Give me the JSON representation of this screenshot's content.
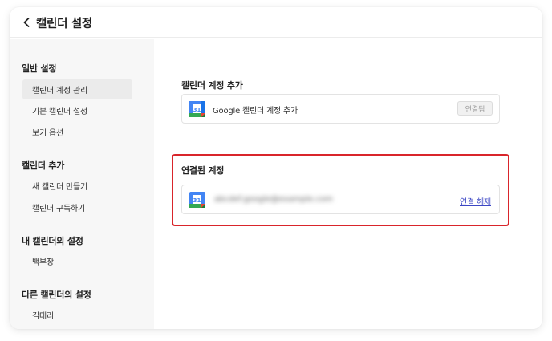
{
  "header": {
    "title": "캘린더 설정",
    "back_icon": "chevron-left-icon"
  },
  "sidebar": {
    "groups": [
      {
        "label": "일반 설정",
        "items": [
          {
            "label": "캘린더 계정 관리",
            "active": true
          },
          {
            "label": "기본 캘린더 설정"
          },
          {
            "label": "보기 옵션"
          }
        ]
      },
      {
        "label": "캘린더 추가",
        "items": [
          {
            "label": "새 캘린더 만들기"
          },
          {
            "label": "캘린더 구독하기"
          }
        ]
      },
      {
        "label": "내 캘린더의 설정",
        "items": [
          {
            "label": "백부장"
          }
        ]
      },
      {
        "label": "다른 캘린더의 설정",
        "items": [
          {
            "label": "김대리"
          }
        ]
      }
    ]
  },
  "main": {
    "add_section": {
      "title": "캘린더 계정 추가",
      "item_label": "Google 캘린더 계정 추가",
      "button_label": "연결됨",
      "icon": "google-calendar-icon",
      "icon_day": "31"
    },
    "connected_section": {
      "title": "연결된 계정",
      "account_email": "abcdef.google@example.com",
      "disconnect_label": "연결 해제",
      "icon": "google-calendar-icon",
      "icon_day": "31"
    }
  },
  "colors": {
    "highlight": "#d9252b",
    "link": "#3b46c4",
    "sidebar_bg": "#f7f7f7"
  }
}
